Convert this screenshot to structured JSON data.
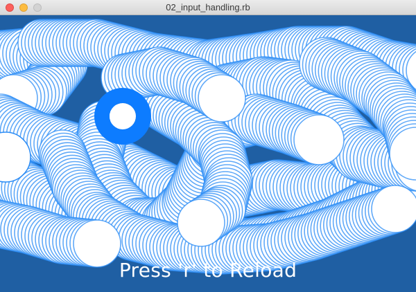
{
  "window": {
    "title": "02_input_handling.rb",
    "controls": {
      "close": "close-button",
      "minimize": "minimize-button",
      "zoom": "zoom-button"
    }
  },
  "canvas": {
    "background_color": "#1f5fa3",
    "ring_stroke_color": "#2b8cf5",
    "ring_fill_color": "#ffffff",
    "cursor_color": "#0d7cff",
    "message": "Press 'r' to Reload"
  }
}
